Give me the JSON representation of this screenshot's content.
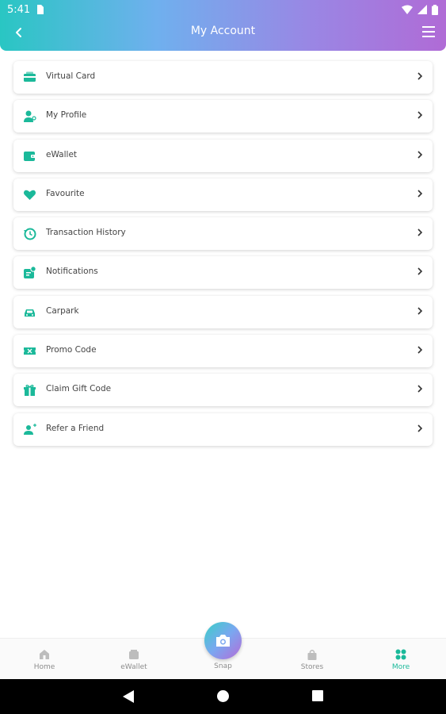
{
  "status_bar": {
    "time": "5:41"
  },
  "header": {
    "title": "My Account"
  },
  "menu_items": [
    {
      "label": "Virtual Card",
      "icon": "card-icon"
    },
    {
      "label": "My Profile",
      "icon": "profile-icon"
    },
    {
      "label": "eWallet",
      "icon": "wallet-icon"
    },
    {
      "label": "Favourite",
      "icon": "heart-icon"
    },
    {
      "label": "Transaction History",
      "icon": "history-icon"
    },
    {
      "label": "Notifications",
      "icon": "notification-icon"
    },
    {
      "label": "Carpark",
      "icon": "car-icon"
    },
    {
      "label": "Promo Code",
      "icon": "ticket-icon"
    },
    {
      "label": "Claim Gift Code",
      "icon": "gift-icon"
    },
    {
      "label": "Refer a Friend",
      "icon": "refer-friend-icon"
    }
  ],
  "bottom_nav": {
    "home": "Home",
    "ewallet": "eWallet",
    "snap": "Snap",
    "stores": "Stores",
    "more": "More"
  },
  "colors": {
    "accent": "#1bb99a",
    "gradient_start": "#29c6c3",
    "gradient_end": "#b06bd6"
  }
}
